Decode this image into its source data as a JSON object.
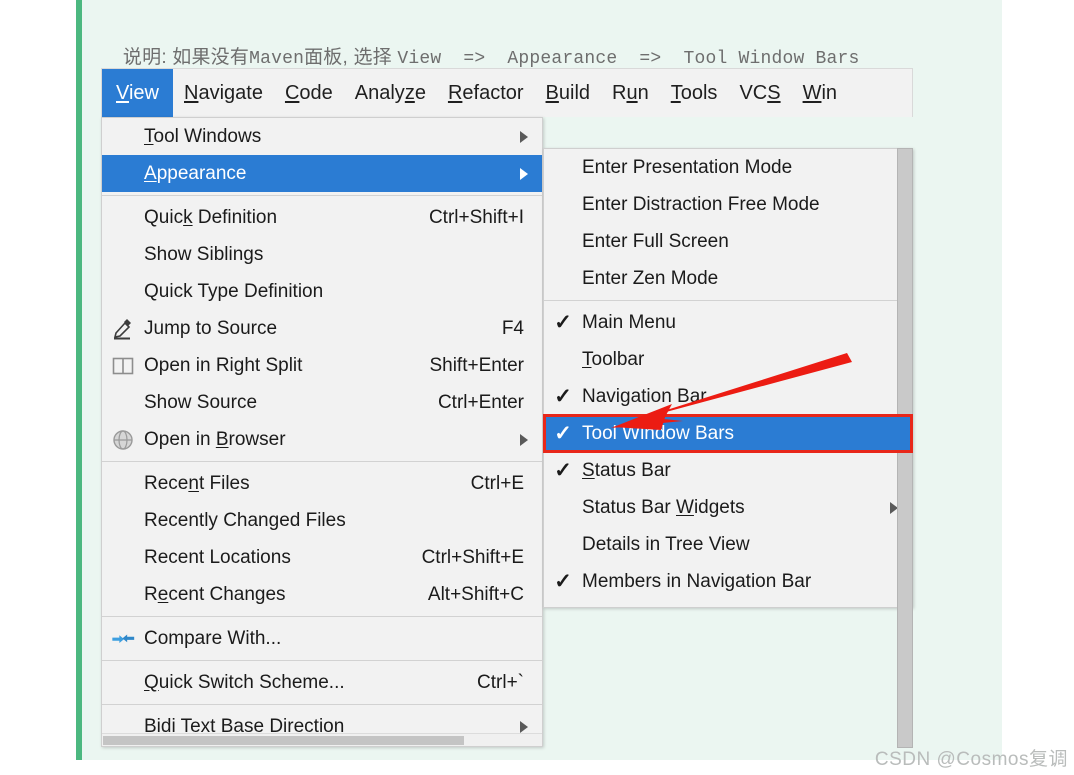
{
  "caption": {
    "prefix": "说明: 如果没有",
    "maven": "Maven",
    "mid": "面板, 选择 ",
    "view": "View",
    "arrow1": "  =>  ",
    "appearance": "Appearance",
    "arrow2": "  =>  ",
    "toolwindowbars": "Tool Window Bars"
  },
  "menubar": {
    "items": [
      {
        "label": "View",
        "mn": "V",
        "active": true
      },
      {
        "label": "Navigate",
        "mn": "N",
        "active": false
      },
      {
        "label": "Code",
        "mn": "C",
        "active": false
      },
      {
        "label": "Analyze",
        "mn": "z",
        "active": false
      },
      {
        "label": "Refactor",
        "mn": "R",
        "active": false
      },
      {
        "label": "Build",
        "mn": "B",
        "active": false
      },
      {
        "label": "Run",
        "mn": "u",
        "active": false
      },
      {
        "label": "Tools",
        "mn": "T",
        "active": false
      },
      {
        "label": "VCS",
        "mn": "S",
        "active": false
      },
      {
        "label": "Win",
        "mn": "W",
        "active": false
      }
    ]
  },
  "view_menu": {
    "items": [
      {
        "label": "Tool Windows",
        "accel": "",
        "icon": "",
        "submenu": true,
        "selected": false,
        "mn": "T"
      },
      {
        "label": "Appearance",
        "accel": "",
        "icon": "",
        "submenu": true,
        "selected": true,
        "mn": "A"
      },
      {
        "separator": true
      },
      {
        "label": "Quick Definition",
        "accel": "Ctrl+Shift+I",
        "icon": "",
        "submenu": false,
        "selected": false,
        "mn": "k"
      },
      {
        "label": "Show Siblings",
        "accel": "",
        "icon": "",
        "submenu": false,
        "selected": false,
        "mn": ""
      },
      {
        "label": "Quick Type Definition",
        "accel": "",
        "icon": "",
        "submenu": false,
        "selected": false,
        "mn": ""
      },
      {
        "label": "Jump to Source",
        "accel": "F4",
        "icon": "pencil-icon",
        "submenu": false,
        "selected": false,
        "mn": ""
      },
      {
        "label": "Open in Right Split",
        "accel": "Shift+Enter",
        "icon": "split-pane-icon",
        "submenu": false,
        "selected": false,
        "mn": ""
      },
      {
        "label": "Show Source",
        "accel": "Ctrl+Enter",
        "icon": "",
        "submenu": false,
        "selected": false,
        "mn": ""
      },
      {
        "label": "Open in Browser",
        "accel": "",
        "icon": "globe-icon",
        "submenu": true,
        "selected": false,
        "mn": "B"
      },
      {
        "separator": true
      },
      {
        "label": "Recent Files",
        "accel": "Ctrl+E",
        "icon": "",
        "submenu": false,
        "selected": false,
        "mn": "n"
      },
      {
        "label": "Recently Changed Files",
        "accel": "",
        "icon": "",
        "submenu": false,
        "selected": false,
        "mn": ""
      },
      {
        "label": "Recent Locations",
        "accel": "Ctrl+Shift+E",
        "icon": "",
        "submenu": false,
        "selected": false,
        "mn": ""
      },
      {
        "label": "Recent Changes",
        "accel": "Alt+Shift+C",
        "icon": "",
        "submenu": false,
        "selected": false,
        "mn": "e"
      },
      {
        "separator": true
      },
      {
        "label": "Compare With...",
        "accel": "",
        "icon": "compare-icon",
        "submenu": false,
        "selected": false,
        "mn": ""
      },
      {
        "separator": true
      },
      {
        "label": "Quick Switch Scheme...",
        "accel": "Ctrl+`",
        "icon": "",
        "submenu": false,
        "selected": false,
        "mn": "Q"
      },
      {
        "separator": true
      },
      {
        "label": "Bidi Text Base Direction",
        "accel": "",
        "icon": "",
        "submenu": true,
        "selected": false,
        "mn": ""
      }
    ]
  },
  "appearance_menu": {
    "items": [
      {
        "label": "Enter Presentation Mode",
        "checked": false,
        "submenu": false,
        "selected": false,
        "mn": ""
      },
      {
        "label": "Enter Distraction Free Mode",
        "checked": false,
        "submenu": false,
        "selected": false,
        "mn": ""
      },
      {
        "label": "Enter Full Screen",
        "checked": false,
        "submenu": false,
        "selected": false,
        "mn": ""
      },
      {
        "label": "Enter Zen Mode",
        "checked": false,
        "submenu": false,
        "selected": false,
        "mn": ""
      },
      {
        "separator": true
      },
      {
        "label": "Main Menu",
        "checked": true,
        "submenu": false,
        "selected": false,
        "mn": ""
      },
      {
        "label": "Toolbar",
        "checked": false,
        "submenu": false,
        "selected": false,
        "mn": "T"
      },
      {
        "label": "Navigation Bar",
        "checked": true,
        "submenu": false,
        "selected": false,
        "mn": ""
      },
      {
        "label": "Tool Window Bars",
        "checked": true,
        "submenu": false,
        "selected": true,
        "mn": ""
      },
      {
        "label": "Status Bar",
        "checked": true,
        "submenu": false,
        "selected": false,
        "mn": "S"
      },
      {
        "label": "Status Bar Widgets",
        "checked": false,
        "submenu": true,
        "selected": false,
        "mn": "W"
      },
      {
        "label": "Details in Tree View",
        "checked": false,
        "submenu": false,
        "selected": false,
        "mn": ""
      },
      {
        "label": "Members in Navigation Bar",
        "checked": true,
        "submenu": false,
        "selected": false,
        "mn": ""
      }
    ]
  },
  "annotation": {
    "arrow_color": "#ec1c13",
    "highlight_box_color": "#e8271a",
    "selection_color": "#2b7cd3"
  },
  "watermark": {
    "text": "CSDN @Cosmos复调"
  }
}
